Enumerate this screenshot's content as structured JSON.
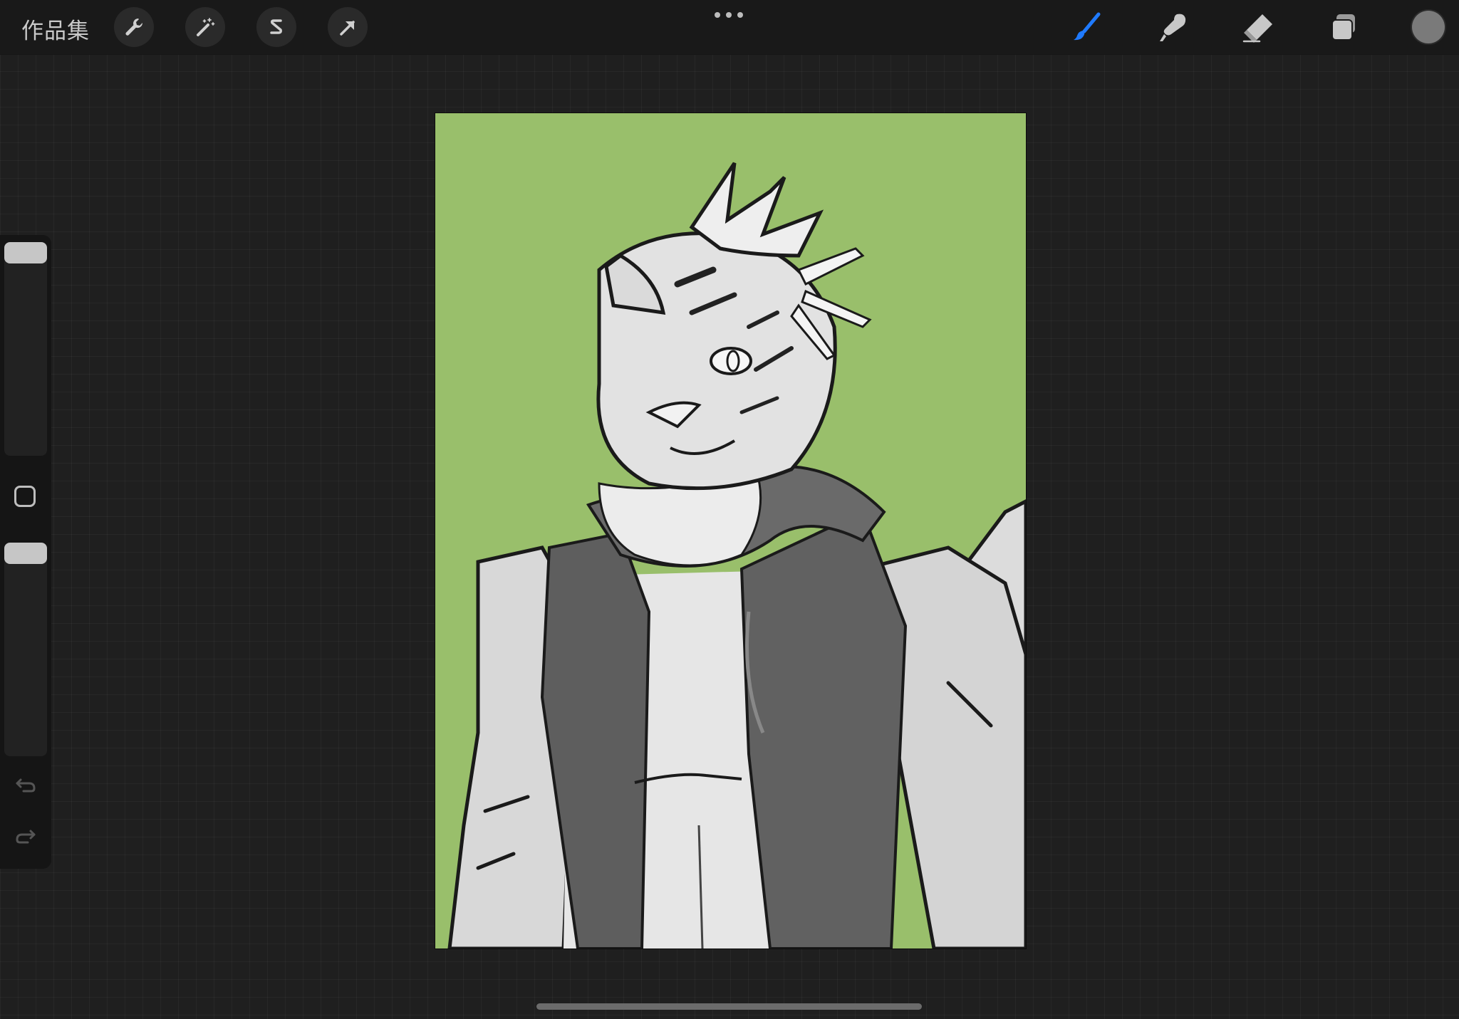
{
  "topbar": {
    "gallery_label": "作品集",
    "left_tools": [
      {
        "name": "actions",
        "icon": "wrench-icon"
      },
      {
        "name": "adjustments",
        "icon": "magic-wand-icon"
      },
      {
        "name": "selection",
        "icon": "selection-s-icon"
      },
      {
        "name": "transform",
        "icon": "arrow-cursor-icon"
      }
    ],
    "more_icon": "ellipsis-icon",
    "right_tools": [
      {
        "name": "brush",
        "icon": "paintbrush-icon",
        "active": true
      },
      {
        "name": "smudge",
        "icon": "smudge-finger-icon",
        "active": false
      },
      {
        "name": "eraser",
        "icon": "eraser-icon",
        "active": false
      },
      {
        "name": "layers",
        "icon": "layers-icon",
        "active": false
      }
    ],
    "current_color": "#7a7a7a"
  },
  "sidebar": {
    "brush_size_level": 1.0,
    "opacity_level": 1.0,
    "modify_icon": "square-icon",
    "undo_icon": "undo-arrow-icon",
    "redo_icon": "redo-arrow-icon"
  },
  "canvas": {
    "background_color": "#99bf6b",
    "subject": "artwork-illustration"
  },
  "colors": {
    "accent_blue": "#1f7aff",
    "ui_icon": "#c8c8c8",
    "topbar_bg": "#191919"
  }
}
